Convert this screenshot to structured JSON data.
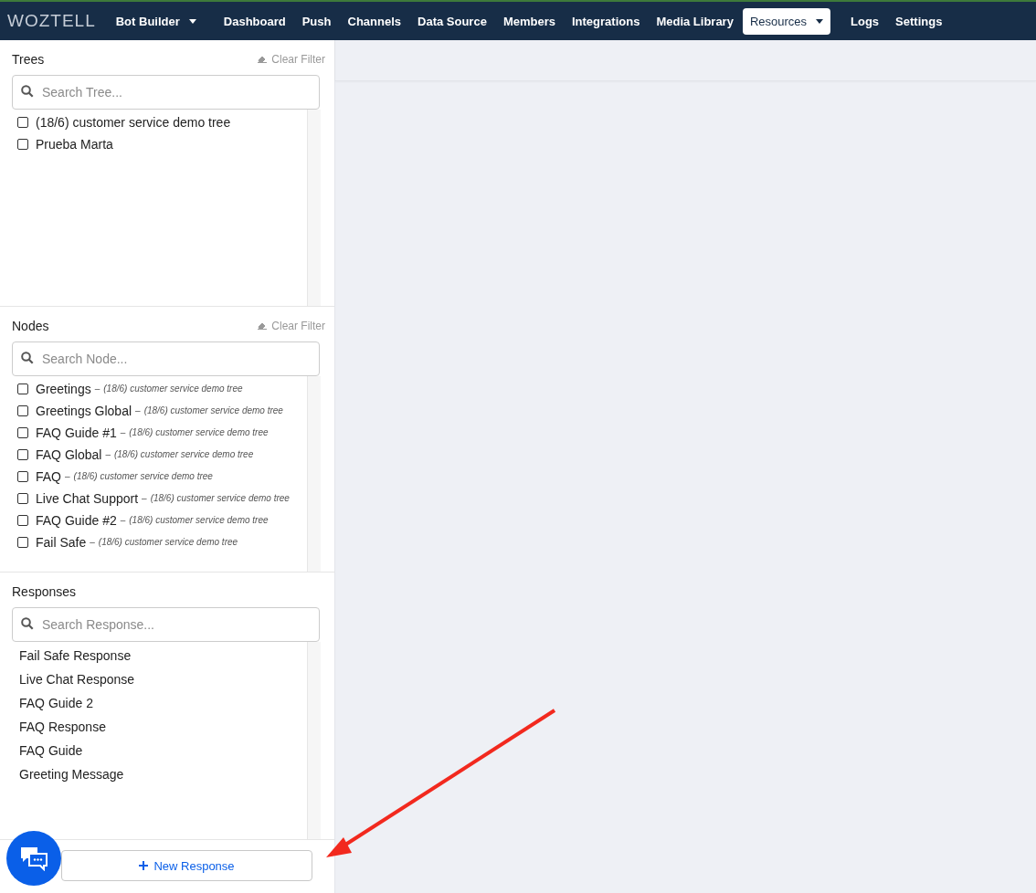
{
  "nav": {
    "logo": "WOZTELL",
    "items": [
      {
        "label": "Bot Builder",
        "dropdown": true,
        "selected": false
      },
      {
        "label": "Dashboard",
        "dropdown": false,
        "selected": false
      },
      {
        "label": "Push",
        "dropdown": false,
        "selected": false
      },
      {
        "label": "Channels",
        "dropdown": false,
        "selected": false
      },
      {
        "label": "Data Source",
        "dropdown": false,
        "selected": false
      },
      {
        "label": "Members",
        "dropdown": false,
        "selected": false
      },
      {
        "label": "Integrations",
        "dropdown": false,
        "selected": false
      },
      {
        "label": "Media Library",
        "dropdown": false,
        "selected": false
      },
      {
        "label": "Resources",
        "dropdown": true,
        "selected": true
      },
      {
        "label": "Logs",
        "dropdown": false,
        "selected": false
      },
      {
        "label": "Settings",
        "dropdown": false,
        "selected": false
      }
    ]
  },
  "sidebar": {
    "sections": [
      {
        "kind": "checklist",
        "title": "Trees",
        "clear_filter": "Clear Filter",
        "search": {
          "placeholder": "Search Tree..."
        },
        "items": [
          {
            "label": "(18/6) customer service demo tree",
            "checked": false
          },
          {
            "label": "Prueba Marta",
            "checked": false
          }
        ]
      },
      {
        "kind": "checklist",
        "title": "Nodes",
        "clear_filter": "Clear Filter",
        "search": {
          "placeholder": "Search Node..."
        },
        "items": [
          {
            "label": "Greetings",
            "separator": "–",
            "tree": "(18/6) customer service demo tree",
            "checked": false
          },
          {
            "label": "Greetings Global",
            "separator": "–",
            "tree": "(18/6) customer service demo tree",
            "checked": false
          },
          {
            "label": "FAQ Guide #1",
            "separator": "–",
            "tree": "(18/6) customer service demo tree",
            "checked": false
          },
          {
            "label": "FAQ Global",
            "separator": "–",
            "tree": "(18/6) customer service demo tree",
            "checked": false
          },
          {
            "label": "FAQ",
            "separator": "–",
            "tree": "(18/6) customer service demo tree",
            "checked": false
          },
          {
            "label": "Live Chat Support",
            "separator": "–",
            "tree": "(18/6) customer service demo tree",
            "checked": false
          },
          {
            "label": "FAQ Guide #2",
            "separator": "–",
            "tree": "(18/6) customer service demo tree",
            "checked": false
          },
          {
            "label": "Fail Safe",
            "separator": "–",
            "tree": "(18/6) customer service demo tree",
            "checked": false
          }
        ]
      },
      {
        "kind": "plain",
        "title": "Responses",
        "search": {
          "placeholder": "Search Response..."
        },
        "items": [
          {
            "label": "Fail Safe Response"
          },
          {
            "label": "Live Chat Response"
          },
          {
            "label": "FAQ Guide 2"
          },
          {
            "label": "FAQ Response"
          },
          {
            "label": "FAQ Guide"
          },
          {
            "label": "Greeting Message"
          }
        ]
      }
    ],
    "new_response_button": "New Response"
  }
}
